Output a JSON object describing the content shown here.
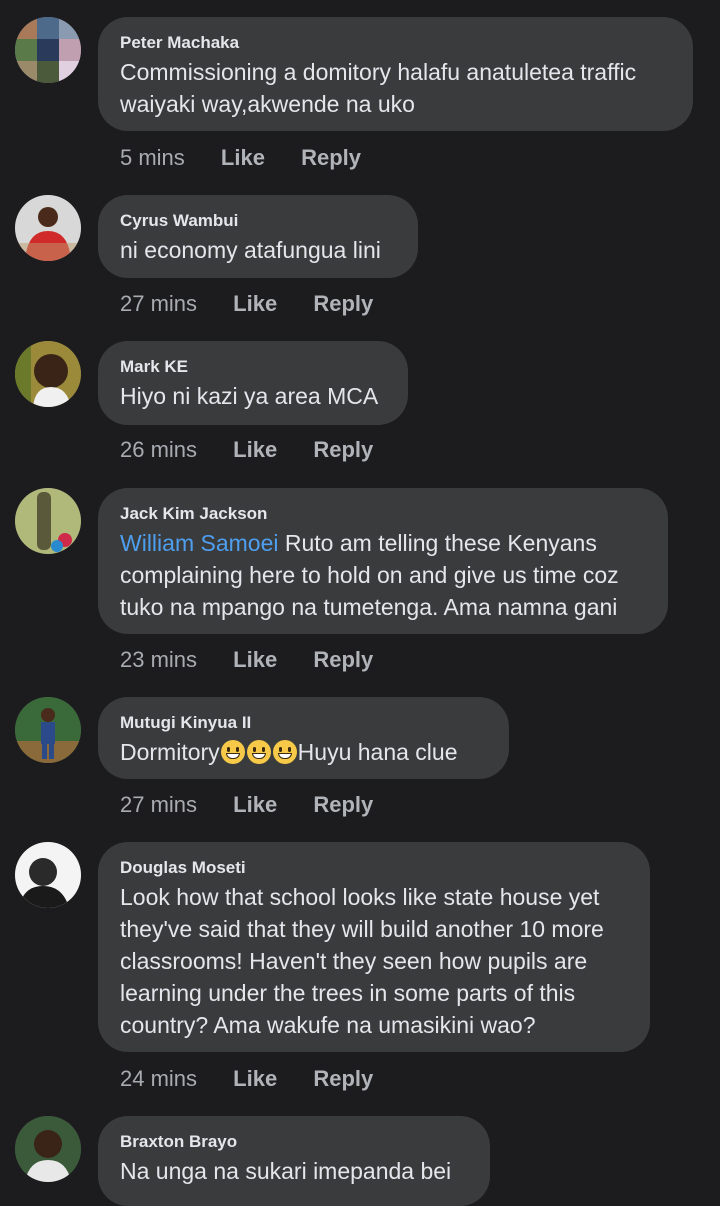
{
  "comments": [
    {
      "author": "Peter Machaka",
      "text": "Commissioning a domitory halafu anatuletea traffic waiyaki way,akwende na uko",
      "time": "5 mins",
      "like": "Like",
      "reply": "Reply"
    },
    {
      "author": "Cyrus Wambui",
      "text": "ni economy atafungua lini",
      "time": "27 mins",
      "like": "Like",
      "reply": "Reply"
    },
    {
      "author": "Mark KE",
      "text": "Hiyo ni kazi ya area MCA",
      "time": "26 mins",
      "like": "Like",
      "reply": "Reply"
    },
    {
      "author": "Jack Kim Jackson",
      "mention": "William Samoei",
      "text": " Ruto am telling these Kenyans complaining here to hold on and give us time coz tuko na mpango na tumetenga. Ama namna gani",
      "time": "23 mins",
      "like": "Like",
      "reply": "Reply"
    },
    {
      "author": "Mutugi Kinyua II",
      "text_before": "Dormitory",
      "text_after": "Huyu hana clue",
      "emoji_name": "grinning-face-emoji",
      "time": "27 mins",
      "like": "Like",
      "reply": "Reply"
    },
    {
      "author": "Douglas Moseti",
      "text": "Look how that school looks like state house yet they've said that they will build another 10 more classrooms! Haven't they seen how pupils are learning under the trees in some parts of this country? Ama wakufe na umasikini wao?",
      "time": "24 mins",
      "like": "Like",
      "reply": "Reply"
    },
    {
      "author": "Braxton Brayo",
      "text": "Na unga na sukari imepanda bei"
    }
  ],
  "colors": {
    "background": "#1c1c1e",
    "bubble": "#3a3b3c",
    "mention": "#4e9ff0"
  }
}
